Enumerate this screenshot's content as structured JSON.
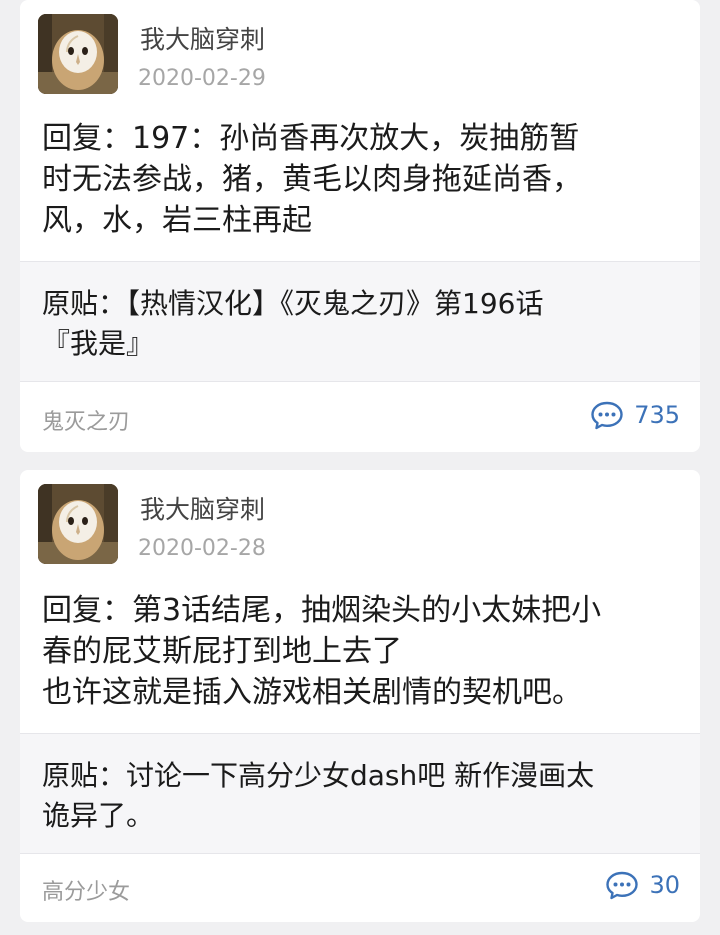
{
  "icons": {
    "avatar": "barn-owl-avatar-icon",
    "comment": "comment-bubble-icon"
  },
  "colors": {
    "comment_accent": "#3c72b8",
    "date_gray": "#a6a6a6",
    "original_bg": "#f6f6f8"
  },
  "posts": [
    {
      "username": "我大脑穿刺",
      "date": "2020-02-29",
      "reply_lines": [
        "回复：197：孙尚香再次放大，炭抽筋暂",
        "时无法参战，猪，黄毛以肉身拖延尚香，",
        "风，水，岩三柱再起"
      ],
      "original_lines": [
        "原贴：【热情汉化】《灭鬼之刃》第196话",
        "『我是』"
      ],
      "tag": "鬼灭之刃",
      "comment_count": "735"
    },
    {
      "username": "我大脑穿刺",
      "date": "2020-02-28",
      "reply_lines": [
        "回复：第3话结尾，抽烟染头的小太妹把小",
        "春的屁艾斯屁打到地上去了",
        "也许这就是插入游戏相关剧情的契机吧。"
      ],
      "original_lines": [
        "原贴：讨论一下高分少女dash吧 新作漫画太",
        "诡异了。"
      ],
      "tag": "高分少女",
      "comment_count": "30"
    }
  ]
}
